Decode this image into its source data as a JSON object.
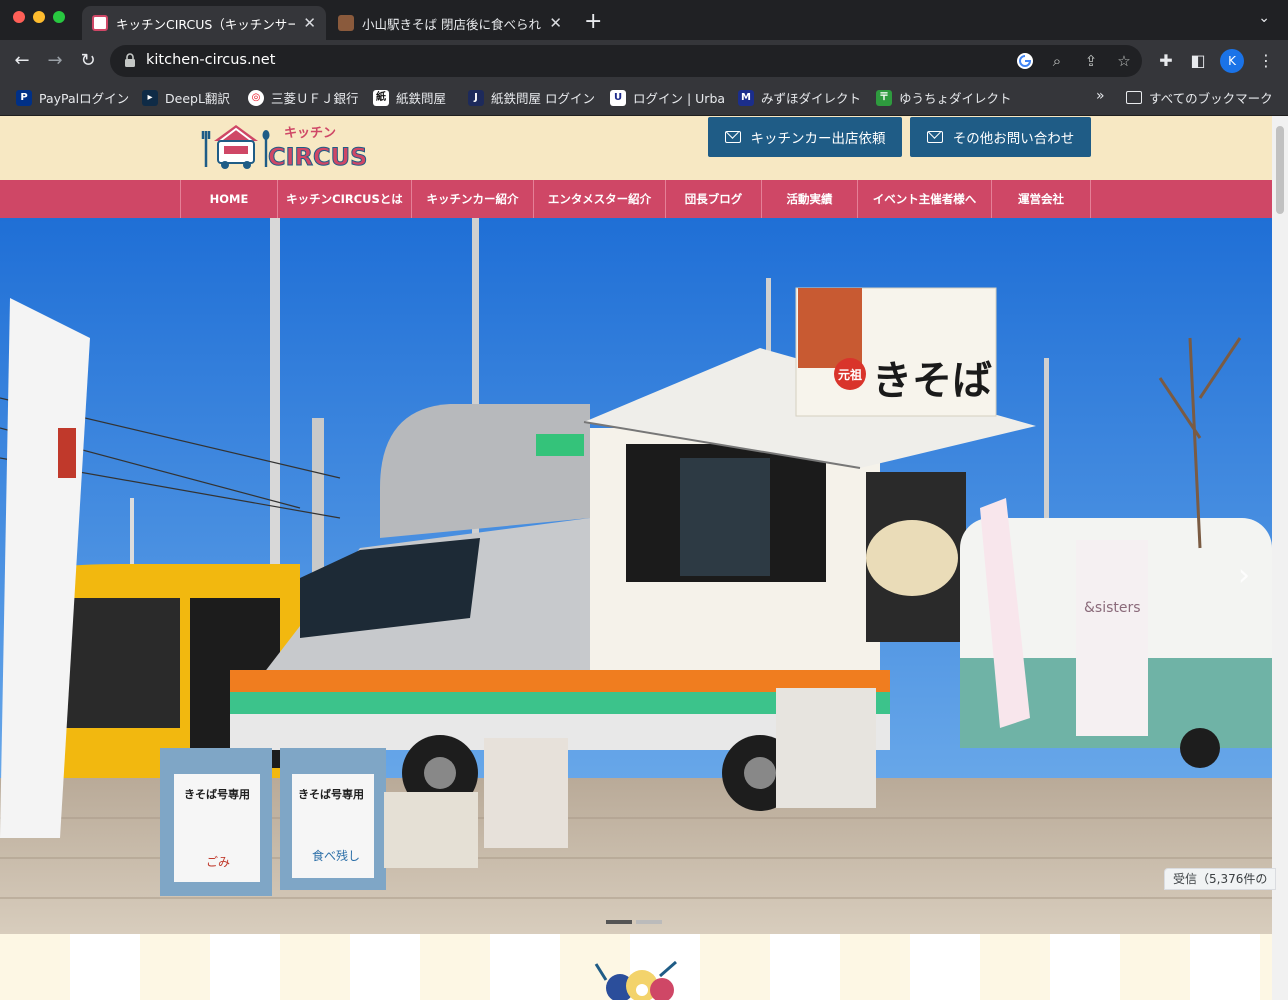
{
  "browser": {
    "tabs": [
      {
        "title": "キッチンCIRCUS（キッチンサー",
        "active": true
      },
      {
        "title": "小山駅きそば 閉店後に食べられ",
        "active": false
      }
    ],
    "url": "kitchen-circus.net",
    "profile_initial": "K",
    "bookmarks": [
      {
        "label": "PayPalログイン",
        "icon": "paypal-icon"
      },
      {
        "label": "DeepL翻訳",
        "icon": "deepl-icon"
      },
      {
        "label": "三菱ＵＦＪ銀行",
        "icon": "mufg-icon"
      },
      {
        "label": "紙鉄問屋",
        "icon": "kamitetsu-icon"
      },
      {
        "label": "紙鉄問屋 ログイン",
        "icon": "j-icon"
      },
      {
        "label": "ログイン | Urba",
        "icon": "u-icon"
      },
      {
        "label": "みずほダイレクト",
        "icon": "mizuho-icon"
      },
      {
        "label": "ゆうちょダイレクト",
        "icon": "jp-bank-icon"
      }
    ],
    "bookmarks_more": "»",
    "all_bookmarks": "すべてのブックマーク",
    "status_text": "受信（5,376件の"
  },
  "site": {
    "logo_text_top": "キッチン",
    "logo_text_main": "CIRCUS",
    "cta_buttons": [
      "キッチンカー出店依頼",
      "その他お問い合わせ"
    ],
    "nav": [
      "HOME",
      "キッチンCIRCUSとは",
      "キッチンカー紹介",
      "エンタメスター紹介",
      "団長ブログ",
      "活動実績",
      "イベント主催者様へ",
      "運営会社"
    ],
    "hero": {
      "sign_text": "きそば",
      "sign_small": "元祖",
      "trash_labels": [
        "きそば号専用",
        "きそば号専用"
      ],
      "trash_sub": [
        "ごみ",
        "食べ残し"
      ],
      "neighbor_sign": "&sisters",
      "slides": 2,
      "active_slide": 1
    },
    "colors": {
      "header_bg": "#f7e8c3",
      "nav_bg": "#cf4766",
      "cta_bg": "#1f5c86"
    }
  }
}
